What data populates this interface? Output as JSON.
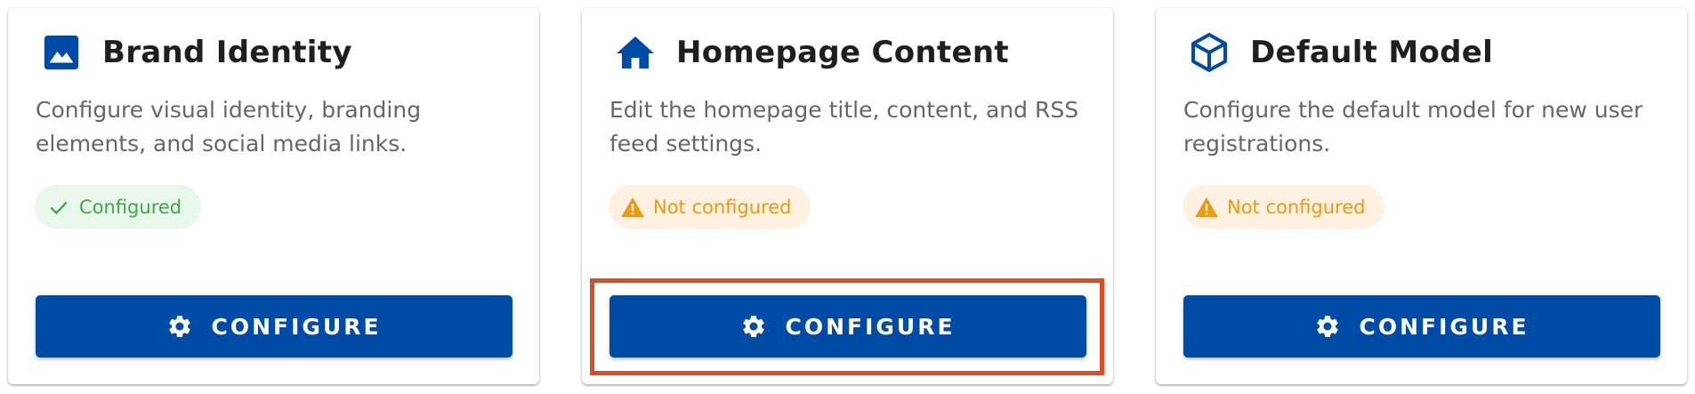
{
  "colors": {
    "primary": "#004ba6",
    "success": "#3fa84a",
    "success_bg": "#e9f7ea",
    "warning": "#ef9a0a",
    "warning_bg": "#fff1e1",
    "highlight": "#e14b1f"
  },
  "cards": [
    {
      "icon": "image-icon",
      "title": "Brand Identity",
      "description": "Configure visual identity, branding elements, and social media links.",
      "status": {
        "icon": "check-icon",
        "label": "Configured",
        "kind": "success"
      },
      "button": {
        "icon": "gear-icon",
        "label": "CONFIGURE"
      }
    },
    {
      "icon": "home-icon",
      "title": "Homepage Content",
      "description": "Edit the homepage title, content, and RSS feed settings.",
      "status": {
        "icon": "warning-icon",
        "label": "Not configured",
        "kind": "warning"
      },
      "button": {
        "icon": "gear-icon",
        "label": "CONFIGURE",
        "highlighted": true
      }
    },
    {
      "icon": "cube-icon",
      "title": "Default Model",
      "description": "Configure the default model for new user registrations.",
      "status": {
        "icon": "warning-icon",
        "label": "Not configured",
        "kind": "warning"
      },
      "button": {
        "icon": "gear-icon",
        "label": "CONFIGURE"
      }
    }
  ]
}
